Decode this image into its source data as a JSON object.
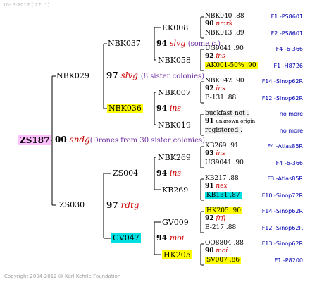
{
  "header": {
    "date_text": "10-  6-2012 ( 22: 1)"
  },
  "footer": {
    "copyright": "Copyright 2004-2012 @ Karl Kehrle Foundation"
  },
  "root": {
    "id": "ZS187",
    "num": "00",
    "name": "sndg",
    "note": "(Drones from 30 sister colonies)"
  },
  "gen1": [
    {
      "id": "NBK029",
      "num": "97",
      "name": "slvg",
      "note": "(8 sister colonies)"
    },
    {
      "id": "ZS030",
      "num": "97",
      "name": "rdtg"
    }
  ],
  "gen2": [
    {
      "id": "NBK037",
      "num": "94",
      "name": "slvg",
      "note": "(some c.)"
    },
    {
      "id": "NBK036",
      "num": "94",
      "name": "ins"
    },
    {
      "id": "ZS004",
      "num": "94",
      "name": "ins"
    },
    {
      "id": "GV047",
      "num": "94",
      "name": "moi"
    }
  ],
  "gen3": [
    {
      "id": "EK008"
    },
    {
      "id": "NBK058"
    },
    {
      "id": "NBK007"
    },
    {
      "id": "NBK019"
    },
    {
      "id": "NBK269"
    },
    {
      "id": "KB269"
    },
    {
      "id": "GV009"
    },
    {
      "id": "HK205"
    }
  ],
  "gen4": [
    {
      "a": "NBK040 .88",
      "mid": "90",
      "midname": "nmrk",
      "b": "NBK013 .89",
      "la": "F1 -PS8601",
      "lb": "F2 -PS8601"
    },
    {
      "a": "UG9041 .90",
      "mid": "92",
      "midname": "ins",
      "b": "AK001-50% .90",
      "la": "F4 -6-366",
      "lb": "F1 -H8726"
    },
    {
      "a": "NBK042 .90",
      "mid": "92",
      "midname": "ins",
      "b": "B-131 .88",
      "la": "F14 -Sinop62R",
      "lb": "F12 -Sinop62R"
    },
    {
      "a": "buckfast not .",
      "mid": "91",
      "midname": "unknown origin",
      "b": "registered .",
      "la": "no more",
      "lb": "no more"
    },
    {
      "a": "KB269 .91",
      "mid": "93",
      "midname": "ins",
      "b": "UG9041 .90",
      "la": "F4 -Atlas85R",
      "lb": "F4 -6-366"
    },
    {
      "a": "KB217 .88",
      "mid": "91",
      "midname": "nex",
      "b": "KB131 .87",
      "la": "F3 -Atlas85R",
      "lb": "F10 -Sinop72R"
    },
    {
      "a": "HK205 .90",
      "mid": "92",
      "midname": "frfj",
      "b": "B-217 .88",
      "la": "F14 -Sinop62R",
      "lb": "F12 -Sinop62R"
    },
    {
      "a": "OO8804 .88",
      "mid": "90",
      "midname": "moi",
      "b": "SV007 .86",
      "la": "F13 -Sinop62R",
      "lb": "F1 -P8200"
    }
  ]
}
